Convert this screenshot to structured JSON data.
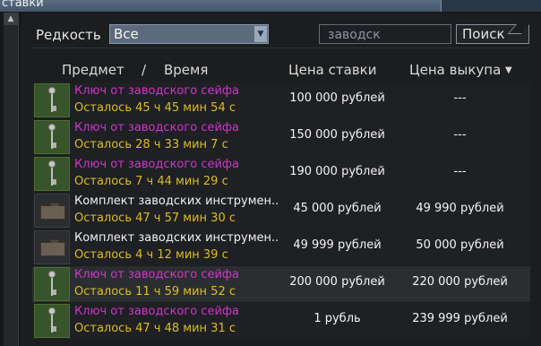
{
  "window": {
    "title": "ставки"
  },
  "filter": {
    "rarity_label": "Редкость",
    "rarity_value": "Все",
    "search_value": "заводск",
    "search_button": "Поиск"
  },
  "headers": {
    "item": "Предмет",
    "separator": "/",
    "time": "Время",
    "bid": "Цена ставки",
    "buyout": "Цена выкупа"
  },
  "rows": [
    {
      "name": "Ключ от заводского сейфа",
      "time": "Осталось 45 ч 45 мин 54 с",
      "bid": "100 000 рублей",
      "buyout": "---",
      "name_color": "magenta",
      "icon": "key-icon",
      "selected": false
    },
    {
      "name": "Ключ от заводского сейфа",
      "time": "Осталось 28 ч 33 мин 7 с",
      "bid": "150 000 рублей",
      "buyout": "---",
      "name_color": "magenta",
      "icon": "key-icon",
      "selected": false
    },
    {
      "name": "Ключ от заводского сейфа",
      "time": "Осталось 7 ч 44 мин 29 с",
      "bid": "190 000 рублей",
      "buyout": "---",
      "name_color": "magenta",
      "icon": "key-icon",
      "selected": false
    },
    {
      "name": "Комплект заводских инструмен..",
      "time": "Осталось 47 ч 57 мин 30 с",
      "bid": "45 000 рублей",
      "buyout": "49 990 рублей",
      "name_color": "white",
      "icon": "toolbox-icon",
      "selected": false
    },
    {
      "name": "Комплект заводских инструмен..",
      "time": "Осталось 4 ч 12 мин 39 с",
      "bid": "49 999 рублей",
      "buyout": "50 000 рублей",
      "name_color": "white",
      "icon": "toolbox-icon",
      "selected": false
    },
    {
      "name": "Ключ от заводского сейфа",
      "time": "Осталось 11 ч 59 мин 52 с",
      "bid": "200 000 рублей",
      "buyout": "220 000 рублей",
      "name_color": "magenta",
      "icon": "key-icon",
      "selected": true
    },
    {
      "name": "Ключ от заводского сейфа",
      "time": "Осталось 47 ч 48 мин 31 с",
      "bid": "1 рубль",
      "buyout": "239 999 рублей",
      "name_color": "magenta",
      "icon": "key-icon",
      "selected": false
    }
  ],
  "colors": {
    "magenta_name": "#cf35c8",
    "white_name": "#f0f0f0",
    "time_yellow": "#ddbc25",
    "title_bar": "#5a6c82"
  }
}
